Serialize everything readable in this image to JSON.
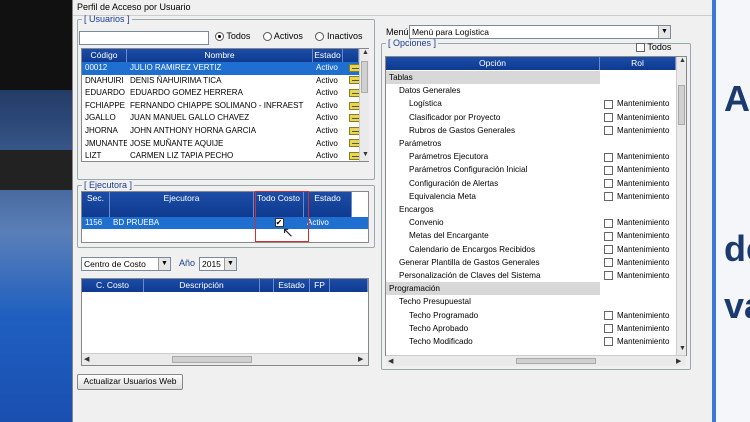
{
  "window": {
    "title": "Perfil de Acceso por Usuario"
  },
  "background_right": {
    "chars": [
      "A",
      "de",
      "va"
    ]
  },
  "usuarios": {
    "legend": "[ Usuarios ]",
    "filters": [
      {
        "label": "Todos",
        "selected": true
      },
      {
        "label": "Activos",
        "selected": false
      },
      {
        "label": "Inactivos",
        "selected": false
      }
    ],
    "search_value": "",
    "columns": [
      "Código",
      "Nombre",
      "Estado"
    ],
    "rows": [
      {
        "codigo": "00012",
        "nombre": "JULIO RAMIREZ VERTIZ",
        "estado": "Activo",
        "selected": true
      },
      {
        "codigo": "DNAHUIRI",
        "nombre": "DENIS ÑAHUIRIMA TICA",
        "estado": "Activo"
      },
      {
        "codigo": "EDUARDO",
        "nombre": "EDUARDO GOMEZ HERRERA",
        "estado": "Activo"
      },
      {
        "codigo": "FCHIAPPE",
        "nombre": "FERNANDO CHIAPPE SOLIMANO - INFRAEST",
        "estado": "Activo"
      },
      {
        "codigo": "JGALLO",
        "nombre": "JUAN MANUEL GALLO CHAVEZ",
        "estado": "Activo"
      },
      {
        "codigo": "JHORNA",
        "nombre": "JOHN ANTHONY HORNA GARCIA",
        "estado": "Activo"
      },
      {
        "codigo": "JMUNANTE",
        "nombre": "JOSE MUÑANTE AQUIJE",
        "estado": "Activo"
      },
      {
        "codigo": "LIZT",
        "nombre": "CARMEN LIZ TAPIA PECHO",
        "estado": "Activo"
      }
    ]
  },
  "ejecutora": {
    "legend": "[ Ejecutora ]",
    "columns": [
      "Sec.",
      "Ejecutora",
      "Todo Costo",
      "Estado"
    ],
    "rows": [
      {
        "sec": "1156",
        "ejecutora": "BD PRUEBA",
        "todo_costo": true,
        "estado": "Activo"
      }
    ]
  },
  "costo": {
    "tipo": "Centro de Costo",
    "anio_label": "Año",
    "anio": "2015",
    "columns": [
      "C. Costo",
      "Descripción",
      "Estado",
      "FP"
    ]
  },
  "actualizar_button": "Actualizar Usuarios Web",
  "menu": {
    "label": "Menú",
    "value": "Menú para Logística"
  },
  "opciones": {
    "legend": "[ Opciones ]",
    "todos_label": "Todos",
    "columns": [
      "Opción",
      "Rol"
    ],
    "rol_label": "Mantenimiento",
    "items": [
      {
        "text": "Tablas",
        "level": 0,
        "group": true,
        "rol": false
      },
      {
        "text": "Datos Generales",
        "level": 1,
        "rol": false
      },
      {
        "text": "Logística",
        "level": 2,
        "rol": true
      },
      {
        "text": "Clasificador por Proyecto",
        "level": 2,
        "rol": true
      },
      {
        "text": "Rubros de Gastos Generales",
        "level": 2,
        "rol": true
      },
      {
        "text": "Parámetros",
        "level": 1,
        "rol": false
      },
      {
        "text": "Parámetros Ejecutora",
        "level": 2,
        "rol": true
      },
      {
        "text": "Parámetros Configuración Inicial",
        "level": 2,
        "rol": true
      },
      {
        "text": "Configuración de Alertas",
        "level": 2,
        "rol": true
      },
      {
        "text": "Equivalencia Meta",
        "level": 2,
        "rol": true
      },
      {
        "text": "Encargos",
        "level": 1,
        "rol": false
      },
      {
        "text": "Convenio",
        "level": 2,
        "rol": true
      },
      {
        "text": "Metas del Encargante",
        "level": 2,
        "rol": true
      },
      {
        "text": "Calendario de Encargos Recibidos",
        "level": 2,
        "rol": true
      },
      {
        "text": "Generar Plantilla de Gastos Generales",
        "level": 1,
        "rol": true
      },
      {
        "text": "Personalización de Claves del Sistema",
        "level": 1,
        "rol": true
      },
      {
        "text": "Programación",
        "level": 0,
        "group": true,
        "rol": false
      },
      {
        "text": "Techo Presupuestal",
        "level": 1,
        "rol": false
      },
      {
        "text": "Techo Programado",
        "level": 2,
        "rol": true
      },
      {
        "text": "Techo Aprobado",
        "level": 2,
        "rol": true
      },
      {
        "text": "Techo Modificado",
        "level": 2,
        "rol": true
      }
    ]
  },
  "colors": {
    "header": "#1c4da8",
    "selection": "#1e6fd0",
    "highlight_box": "#d03030"
  }
}
